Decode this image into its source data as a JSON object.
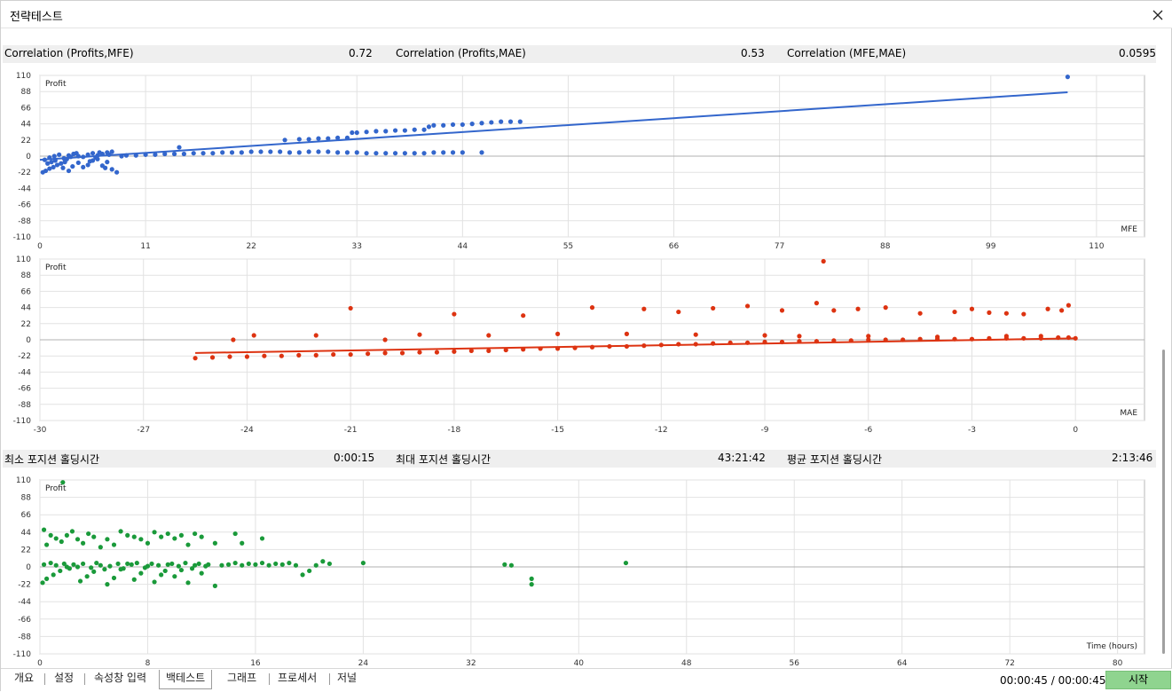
{
  "window": {
    "title": "전략테스트"
  },
  "stats_top": [
    {
      "label": "Correlation (Profits,MFE)",
      "value": "0.72"
    },
    {
      "label": "Correlation (Profits,MAE)",
      "value": "0.53"
    },
    {
      "label": "Correlation (MFE,MAE)",
      "value": "0.0595"
    }
  ],
  "stats_bottom": [
    {
      "label": "최소 포지션 홀딩시간",
      "value": "0:00:15"
    },
    {
      "label": "최대 포지션 홀딩시간",
      "value": "43:21:42"
    },
    {
      "label": "평균 포지션 홀딩시간",
      "value": "2:13:46"
    }
  ],
  "chart_data": [
    {
      "type": "scatter",
      "ylabel": "Profit",
      "xlabel": "MFE",
      "color": "#3366cc",
      "xlim": [
        0,
        115
      ],
      "ylim": [
        -110,
        110
      ],
      "x_ticks": [
        "0",
        "11",
        "22",
        "33",
        "44",
        "55",
        "66",
        "77",
        "88",
        "99",
        "110"
      ],
      "y_ticks": [
        "110",
        "88",
        "66",
        "44",
        "22",
        "0",
        "-22",
        "-44",
        "-66",
        "-88",
        "-110"
      ],
      "trendline": [
        [
          0,
          -5
        ],
        [
          107,
          87
        ]
      ],
      "points": [
        [
          0.3,
          -22
        ],
        [
          0.6,
          -20
        ],
        [
          1,
          -17
        ],
        [
          1.4,
          -15
        ],
        [
          1.8,
          -12
        ],
        [
          2.2,
          -10
        ],
        [
          2.6,
          -8
        ],
        [
          3,
          -20
        ],
        [
          3.4,
          -14
        ],
        [
          4,
          -9
        ],
        [
          4.5,
          -15
        ],
        [
          5,
          -12
        ],
        [
          5.5,
          -6
        ],
        [
          6,
          -4
        ],
        [
          6.5,
          -13
        ],
        [
          7,
          -8
        ],
        [
          7.5,
          -18
        ],
        [
          8,
          -22
        ],
        [
          0.5,
          -5
        ],
        [
          1,
          -2
        ],
        [
          1.5,
          0
        ],
        [
          2,
          2
        ],
        [
          2.5,
          -3
        ],
        [
          3,
          1
        ],
        [
          3.5,
          3
        ],
        [
          4,
          0
        ],
        [
          4.5,
          -1
        ],
        [
          5,
          2
        ],
        [
          5.5,
          4
        ],
        [
          6,
          1
        ],
        [
          6.5,
          3
        ],
        [
          7,
          5
        ],
        [
          7.5,
          6
        ],
        [
          0.8,
          -10
        ],
        [
          1.2,
          -8
        ],
        [
          1.6,
          -6
        ],
        [
          2.4,
          -16
        ],
        [
          2.8,
          -4
        ],
        [
          3.2,
          -1
        ],
        [
          3.8,
          4
        ],
        [
          5.2,
          -7
        ],
        [
          5.8,
          -2
        ],
        [
          6.2,
          5
        ],
        [
          6.8,
          -16
        ],
        [
          7.2,
          2
        ],
        [
          8.5,
          0
        ],
        [
          9,
          1
        ],
        [
          10,
          1
        ],
        [
          11,
          2
        ],
        [
          12,
          2
        ],
        [
          13,
          3
        ],
        [
          14,
          3
        ],
        [
          14.5,
          12
        ],
        [
          15,
          3
        ],
        [
          16,
          4
        ],
        [
          17,
          4
        ],
        [
          18,
          4
        ],
        [
          19,
          5
        ],
        [
          20,
          5
        ],
        [
          21,
          5
        ],
        [
          22,
          6
        ],
        [
          23,
          6
        ],
        [
          24,
          6
        ],
        [
          25,
          6
        ],
        [
          26,
          5
        ],
        [
          27,
          5
        ],
        [
          28,
          6
        ],
        [
          29,
          6
        ],
        [
          30,
          6
        ],
        [
          31,
          5
        ],
        [
          32,
          5
        ],
        [
          33,
          5
        ],
        [
          34,
          4
        ],
        [
          35,
          4
        ],
        [
          36,
          4
        ],
        [
          37,
          4
        ],
        [
          38,
          4
        ],
        [
          39,
          4
        ],
        [
          40,
          4
        ],
        [
          41,
          5
        ],
        [
          42,
          5
        ],
        [
          43,
          5
        ],
        [
          44,
          5
        ],
        [
          46,
          5
        ],
        [
          25.5,
          22
        ],
        [
          27,
          23
        ],
        [
          28,
          23
        ],
        [
          29,
          24
        ],
        [
          30,
          24
        ],
        [
          31,
          25
        ],
        [
          32,
          25
        ],
        [
          32.5,
          32
        ],
        [
          33,
          32
        ],
        [
          34,
          33
        ],
        [
          35,
          34
        ],
        [
          36,
          34
        ],
        [
          37,
          35
        ],
        [
          38,
          35
        ],
        [
          39,
          36
        ],
        [
          40,
          36
        ],
        [
          40.5,
          40
        ],
        [
          41,
          42
        ],
        [
          42,
          42
        ],
        [
          43,
          43
        ],
        [
          44,
          43
        ],
        [
          45,
          44
        ],
        [
          46,
          45
        ],
        [
          47,
          46
        ],
        [
          48,
          47
        ],
        [
          49,
          47
        ],
        [
          50,
          47
        ],
        [
          107,
          108
        ]
      ]
    },
    {
      "type": "scatter",
      "ylabel": "Profit",
      "xlabel": "MAE",
      "color": "#dd3311",
      "xlim": [
        -30,
        2
      ],
      "ylim": [
        -110,
        110
      ],
      "x_ticks": [
        "-30",
        "-27",
        "-24",
        "-21",
        "-18",
        "-15",
        "-12",
        "-9",
        "-6",
        "-3",
        "0"
      ],
      "y_ticks": [
        "110",
        "88",
        "66",
        "44",
        "22",
        "0",
        "-22",
        "-44",
        "-66",
        "-88",
        "-110"
      ],
      "trendline": [
        [
          -25.5,
          -18
        ],
        [
          0,
          2
        ]
      ],
      "points": [
        [
          -25.5,
          -25
        ],
        [
          -25,
          -24
        ],
        [
          -24.5,
          -23
        ],
        [
          -24,
          -23
        ],
        [
          -23.5,
          -22
        ],
        [
          -23,
          -22
        ],
        [
          -22.5,
          -21
        ],
        [
          -22,
          -21
        ],
        [
          -21.5,
          -20
        ],
        [
          -21,
          -20
        ],
        [
          -20.5,
          -19
        ],
        [
          -20,
          -18
        ],
        [
          -19.5,
          -18
        ],
        [
          -19,
          -17
        ],
        [
          -18.5,
          -17
        ],
        [
          -18,
          -16
        ],
        [
          -17.5,
          -15
        ],
        [
          -17,
          -15
        ],
        [
          -16.5,
          -14
        ],
        [
          -16,
          -13
        ],
        [
          -15.5,
          -12
        ],
        [
          -15,
          -12
        ],
        [
          -14.5,
          -11
        ],
        [
          -14,
          -10
        ],
        [
          -13.5,
          -9
        ],
        [
          -13,
          -9
        ],
        [
          -12.5,
          -8
        ],
        [
          -12,
          -7
        ],
        [
          -11.5,
          -6
        ],
        [
          -11,
          -6
        ],
        [
          -10.5,
          -5
        ],
        [
          -10,
          -4
        ],
        [
          -9.5,
          -4
        ],
        [
          -9,
          -3
        ],
        [
          -8.5,
          -3
        ],
        [
          -8,
          -2
        ],
        [
          -7.5,
          -2
        ],
        [
          -7,
          -1
        ],
        [
          -6.5,
          -1
        ],
        [
          -6,
          0
        ],
        [
          -5.5,
          0
        ],
        [
          -5,
          0
        ],
        [
          -4.5,
          1
        ],
        [
          -4,
          1
        ],
        [
          -3.5,
          1
        ],
        [
          -3,
          1
        ],
        [
          -2.5,
          2
        ],
        [
          -2,
          2
        ],
        [
          -1.5,
          2
        ],
        [
          -1,
          2
        ],
        [
          -0.5,
          3
        ],
        [
          -0.2,
          3
        ],
        [
          0,
          2
        ],
        [
          -24.4,
          0
        ],
        [
          -23.8,
          6
        ],
        [
          -21,
          43
        ],
        [
          -20,
          0
        ],
        [
          -18,
          35
        ],
        [
          -16,
          33
        ],
        [
          -14,
          44
        ],
        [
          -12.5,
          42
        ],
        [
          -11.5,
          38
        ],
        [
          -10.5,
          43
        ],
        [
          -9.5,
          46
        ],
        [
          -8.5,
          40
        ],
        [
          -7.5,
          50
        ],
        [
          -7,
          40
        ],
        [
          -6.3,
          42
        ],
        [
          -5.5,
          44
        ],
        [
          -4.5,
          36
        ],
        [
          -3.5,
          38
        ],
        [
          -3,
          42
        ],
        [
          -2.5,
          37
        ],
        [
          -2,
          36
        ],
        [
          -1.5,
          35
        ],
        [
          -0.8,
          42
        ],
        [
          -0.4,
          40
        ],
        [
          -0.2,
          47
        ],
        [
          -7.3,
          107
        ],
        [
          -22,
          6
        ],
        [
          -19,
          7
        ],
        [
          -17,
          6
        ],
        [
          -15,
          8
        ],
        [
          -13,
          8
        ],
        [
          -11,
          7
        ],
        [
          -9,
          6
        ],
        [
          -8,
          5
        ],
        [
          -6,
          5
        ],
        [
          -4,
          4
        ],
        [
          -2,
          5
        ],
        [
          -1,
          5
        ]
      ]
    },
    {
      "type": "scatter",
      "ylabel": "Profit",
      "xlabel": "Time (hours)",
      "color": "#1a9a3a",
      "xlim": [
        0,
        82
      ],
      "ylim": [
        -110,
        110
      ],
      "x_ticks": [
        "0",
        "8",
        "16",
        "24",
        "32",
        "40",
        "48",
        "56",
        "64",
        "72",
        "80"
      ],
      "y_ticks": [
        "110",
        "88",
        "66",
        "44",
        "22",
        "0",
        "-22",
        "-44",
        "-66",
        "-88",
        "-110"
      ],
      "points": [
        [
          0.2,
          -20
        ],
        [
          0.5,
          -15
        ],
        [
          1,
          -10
        ],
        [
          1.5,
          -5
        ],
        [
          2,
          0
        ],
        [
          2.5,
          3
        ],
        [
          3,
          -18
        ],
        [
          3.5,
          -12
        ],
        [
          4,
          -6
        ],
        [
          4.5,
          2
        ],
        [
          5,
          -22
        ],
        [
          5.5,
          -14
        ],
        [
          6,
          -3
        ],
        [
          6.5,
          4
        ],
        [
          7,
          -16
        ],
        [
          7.5,
          -8
        ],
        [
          8,
          1
        ],
        [
          8.5,
          -19
        ],
        [
          9,
          -10
        ],
        [
          9.5,
          3
        ],
        [
          10,
          -12
        ],
        [
          10.5,
          -4
        ],
        [
          11,
          -20
        ],
        [
          11.5,
          2
        ],
        [
          12,
          -8
        ],
        [
          12.5,
          3
        ],
        [
          13,
          -24
        ],
        [
          13.5,
          2
        ],
        [
          0.3,
          3
        ],
        [
          0.8,
          5
        ],
        [
          1.2,
          2
        ],
        [
          1.8,
          4
        ],
        [
          2.2,
          -2
        ],
        [
          2.8,
          0
        ],
        [
          3.2,
          4
        ],
        [
          3.8,
          -1
        ],
        [
          4.2,
          5
        ],
        [
          4.8,
          -3
        ],
        [
          5.2,
          1
        ],
        [
          5.8,
          4
        ],
        [
          6.2,
          -2
        ],
        [
          6.8,
          3
        ],
        [
          7.2,
          5
        ],
        [
          7.8,
          -1
        ],
        [
          8.3,
          4
        ],
        [
          8.8,
          2
        ],
        [
          9.3,
          -5
        ],
        [
          9.8,
          4
        ],
        [
          10.3,
          1
        ],
        [
          10.8,
          5
        ],
        [
          11.3,
          -2
        ],
        [
          11.8,
          4
        ],
        [
          12.3,
          1
        ],
        [
          0.3,
          47
        ],
        [
          0.5,
          28
        ],
        [
          0.8,
          40
        ],
        [
          1.2,
          36
        ],
        [
          1.6,
          32
        ],
        [
          2,
          40
        ],
        [
          2.4,
          45
        ],
        [
          2.8,
          35
        ],
        [
          3.2,
          30
        ],
        [
          3.6,
          42
        ],
        [
          4,
          38
        ],
        [
          4.5,
          25
        ],
        [
          5,
          35
        ],
        [
          5.5,
          28
        ],
        [
          6,
          45
        ],
        [
          6.5,
          40
        ],
        [
          7,
          38
        ],
        [
          7.5,
          35
        ],
        [
          8,
          30
        ],
        [
          8.5,
          44
        ],
        [
          9,
          38
        ],
        [
          9.5,
          42
        ],
        [
          10,
          36
        ],
        [
          10.5,
          40
        ],
        [
          11,
          28
        ],
        [
          11.5,
          42
        ],
        [
          12,
          38
        ],
        [
          13,
          30
        ],
        [
          14.5,
          42
        ],
        [
          15,
          30
        ],
        [
          16.5,
          36
        ],
        [
          1.7,
          107
        ],
        [
          14,
          3
        ],
        [
          14.5,
          5
        ],
        [
          15,
          2
        ],
        [
          15.5,
          4
        ],
        [
          16,
          3
        ],
        [
          16.5,
          5
        ],
        [
          17,
          2
        ],
        [
          17.5,
          4
        ],
        [
          18,
          3
        ],
        [
          18.5,
          5
        ],
        [
          19,
          2
        ],
        [
          19.5,
          -10
        ],
        [
          20,
          -5
        ],
        [
          20.5,
          2
        ],
        [
          21,
          7
        ],
        [
          21.5,
          4
        ],
        [
          24,
          5
        ],
        [
          34.5,
          3
        ],
        [
          35,
          2
        ],
        [
          36.5,
          -15
        ],
        [
          36.5,
          -22
        ],
        [
          43.5,
          5
        ]
      ]
    }
  ],
  "tabs": [
    {
      "label": "개요",
      "active": false
    },
    {
      "label": "설정",
      "active": false
    },
    {
      "label": "속성창 입력",
      "active": false
    },
    {
      "label": "백테스트",
      "active": true
    },
    {
      "label": "그래프",
      "active": false
    },
    {
      "label": "프로세서",
      "active": false
    },
    {
      "label": "저널",
      "active": false
    }
  ],
  "status": {
    "time": "00:00:45 / 00:00:45",
    "start_label": "시작"
  }
}
